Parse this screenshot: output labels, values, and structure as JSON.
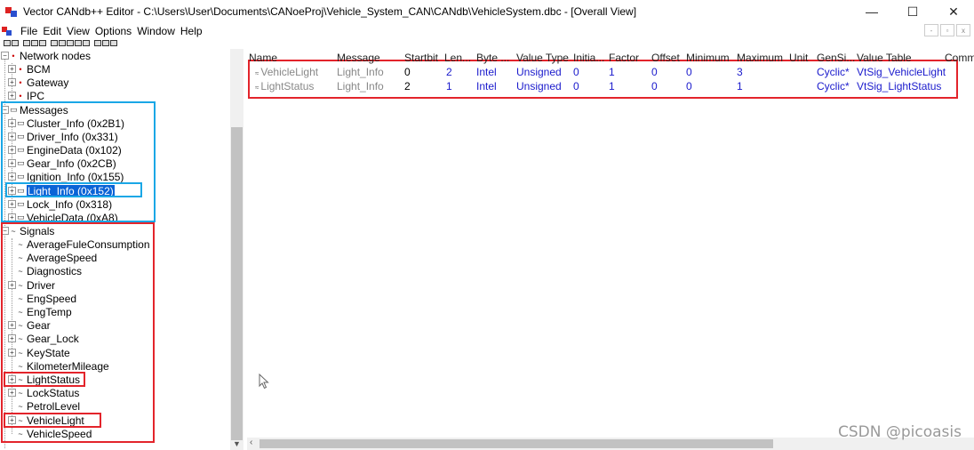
{
  "window": {
    "title": "Vector CANdb++ Editor - C:\\Users\\User\\Documents\\CANoeProj\\Vehicle_System_CAN\\CANdb\\VehicleSystem.dbc - [Overall View]",
    "minimize": "—",
    "maximize": "☐",
    "close": "✕"
  },
  "menu": [
    "File",
    "Edit",
    "View",
    "Options",
    "Window",
    "Help"
  ],
  "mdi": [
    "-",
    "▫",
    "x"
  ],
  "tree": {
    "network_nodes": {
      "label": "Network nodes",
      "children": [
        "BCM",
        "Gateway",
        "IPC"
      ]
    },
    "messages": {
      "label": "Messages",
      "children": [
        "Cluster_Info (0x2B1)",
        "Driver_Info (0x331)",
        "EngineData (0x102)",
        "Gear_Info (0x2CB)",
        "Ignition_Info (0x155)",
        "Light_Info (0x152)",
        "Lock_Info (0x318)",
        "VehicleData (0xA8)"
      ],
      "selected": "Light_Info (0x152)"
    },
    "signals": {
      "label": "Signals",
      "children": [
        {
          "name": "AverageFuleConsumption",
          "expandable": false
        },
        {
          "name": "AverageSpeed",
          "expandable": false
        },
        {
          "name": "Diagnostics",
          "expandable": false
        },
        {
          "name": "Driver",
          "expandable": true
        },
        {
          "name": "EngSpeed",
          "expandable": false
        },
        {
          "name": "EngTemp",
          "expandable": false
        },
        {
          "name": "Gear",
          "expandable": true
        },
        {
          "name": "Gear_Lock",
          "expandable": true
        },
        {
          "name": "KeyState",
          "expandable": true
        },
        {
          "name": "KilometerMileage",
          "expandable": false
        },
        {
          "name": "LightStatus",
          "expandable": true
        },
        {
          "name": "LockStatus",
          "expandable": true
        },
        {
          "name": "PetrolLevel",
          "expandable": false
        },
        {
          "name": "VehicleLight",
          "expandable": true
        },
        {
          "name": "VehicleSpeed",
          "expandable": false
        }
      ]
    }
  },
  "grid": {
    "columns": [
      "Name",
      "Message",
      "Startbit",
      "Len...",
      "Byte ...",
      "Value Type",
      "Initia...",
      "Factor",
      "Offset",
      "Minimum",
      "Maximum",
      "Unit",
      "GenSi...",
      "Value Table",
      "Comm"
    ],
    "rows": [
      {
        "name": "VehicleLight",
        "message": "Light_Info",
        "startbit": "0",
        "length": "2",
        "byte_order": "Intel",
        "value_type": "Unsigned",
        "initial": "0",
        "factor": "1",
        "offset": "0",
        "minimum": "0",
        "maximum": "3",
        "unit": "",
        "gensig": "Cyclic*",
        "value_table": "VtSig_VehicleLight"
      },
      {
        "name": "LightStatus",
        "message": "Light_Info",
        "startbit": "2",
        "length": "1",
        "byte_order": "Intel",
        "value_type": "Unsigned",
        "initial": "0",
        "factor": "1",
        "offset": "0",
        "minimum": "0",
        "maximum": "1",
        "unit": "",
        "gensig": "Cyclic*",
        "value_table": "VtSig_LightStatus"
      }
    ]
  },
  "watermark": "CSDN @picoasis"
}
